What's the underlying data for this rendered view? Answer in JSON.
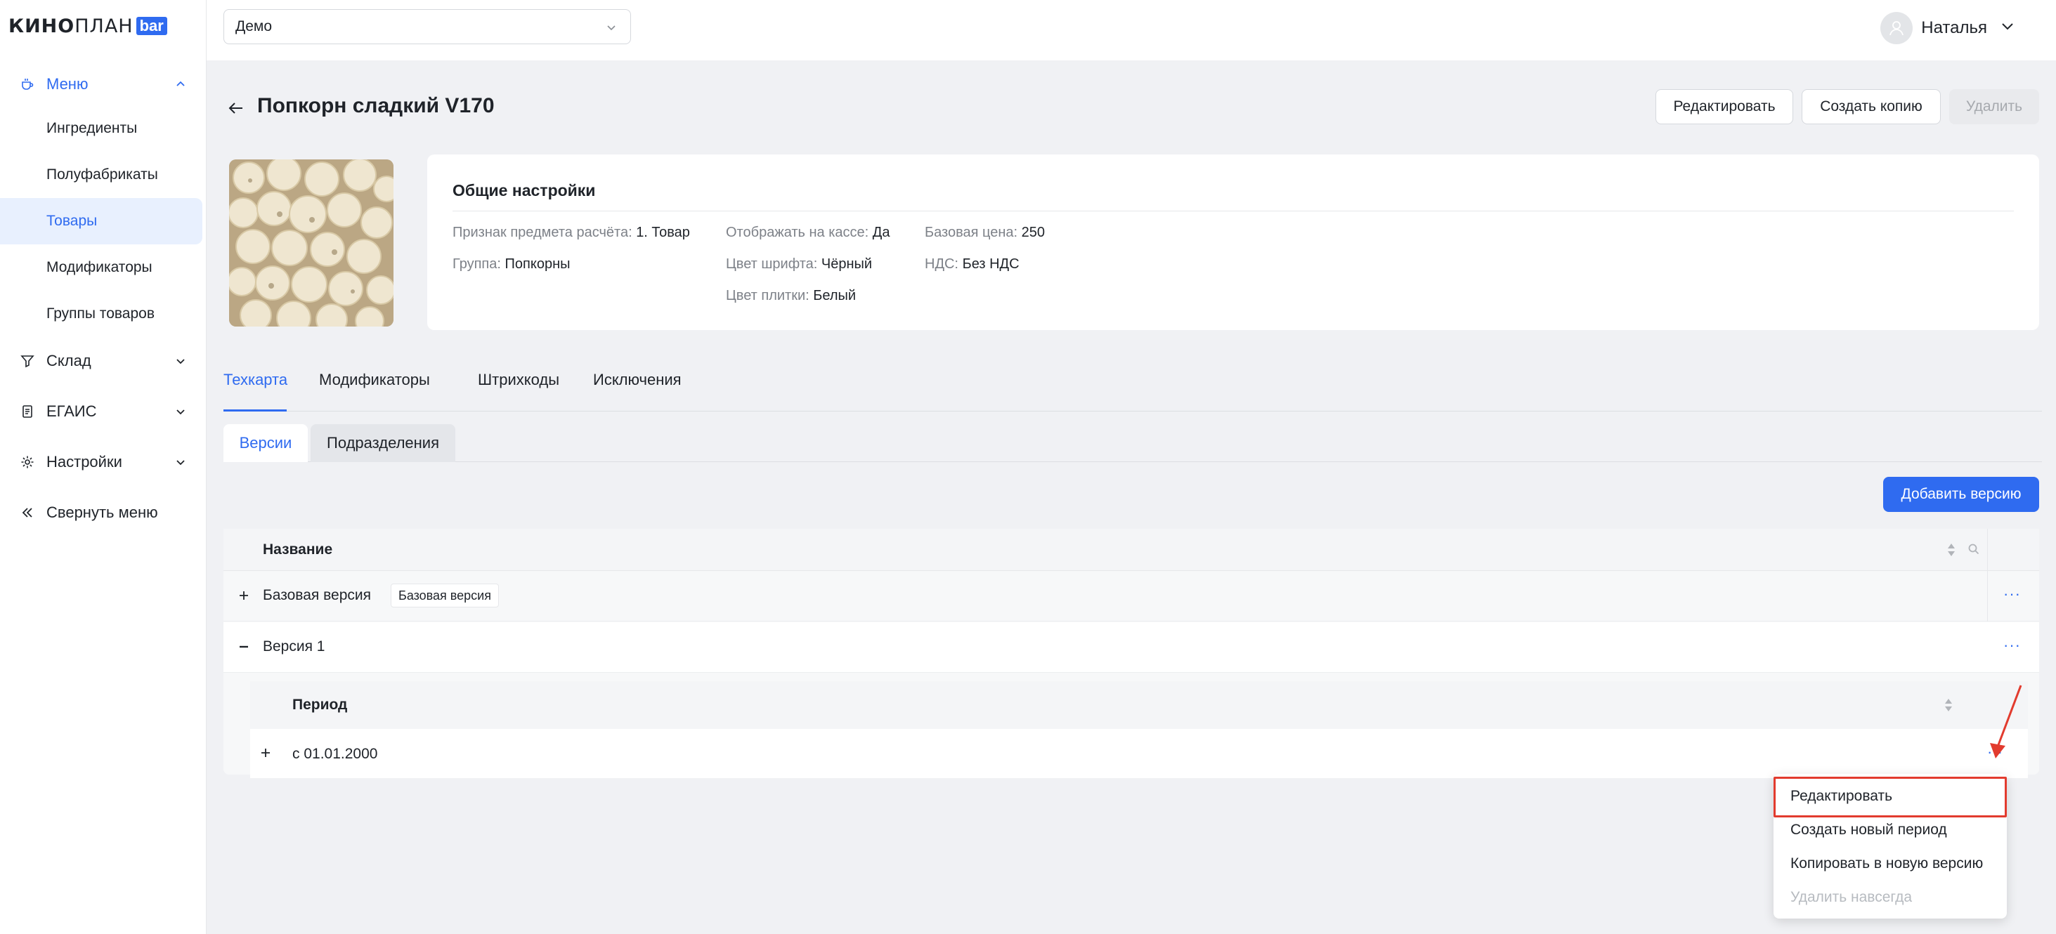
{
  "logo": {
    "bold": "КИНО",
    "thin": "ПЛАН",
    "badge": "bar"
  },
  "sidebar": {
    "sections": [
      {
        "label": "Меню",
        "icon": "coffee-cup-icon"
      },
      {
        "label": "Склад",
        "icon": "funnel-icon"
      },
      {
        "label": "ЕГАИС",
        "icon": "document-icon"
      },
      {
        "label": "Настройки",
        "icon": "gear-icon"
      },
      {
        "label": "Свернуть меню",
        "icon": "double-chevron-left-icon"
      }
    ],
    "menu_items": [
      "Ингредиенты",
      "Полуфабрикаты",
      "Товары",
      "Модификаторы",
      "Группы товаров"
    ]
  },
  "topbar": {
    "select_value": "Демо",
    "user_name": "Наталья"
  },
  "page": {
    "title": "Попкорн сладкий V170",
    "buttons": {
      "edit": "Редактировать",
      "copy": "Создать копию",
      "delete": "Удалить"
    }
  },
  "general": {
    "title": "Общие настройки",
    "props": {
      "payment_key": "Признак предмета расчёта:",
      "payment_val": "1. Товар",
      "group_key": "Группа:",
      "group_val": "Попкорны",
      "cash_key": "Отображать на кассе:",
      "cash_val": "Да",
      "font_key": "Цвет шрифта:",
      "font_val": "Чёрный",
      "tile_key": "Цвет плитки:",
      "tile_val": "Белый",
      "price_key": "Базовая цена:",
      "price_val": "250",
      "vat_key": "НДС:",
      "vat_val": "Без НДС"
    }
  },
  "tabs": [
    "Техкарта",
    "Модификаторы",
    "Штрихкоды",
    "Исключения"
  ],
  "subtabs": [
    "Версии",
    "Подразделения"
  ],
  "add_version": "Добавить версию",
  "versions_table": {
    "header": "Название",
    "rows": [
      {
        "name": "Базовая версия",
        "tag": "Базовая версия"
      },
      {
        "name": "Версия 1"
      }
    ],
    "row_action": "···"
  },
  "periods_table": {
    "header": "Период",
    "rows": [
      {
        "name": "с 01.01.2000"
      }
    ],
    "row_action": "···"
  },
  "context_menu": [
    "Редактировать",
    "Создать новый период",
    "Копировать в новую версию",
    "Удалить навсегда"
  ],
  "colors": {
    "accent": "#2f6bf0",
    "highlight": "#e23b2e"
  }
}
